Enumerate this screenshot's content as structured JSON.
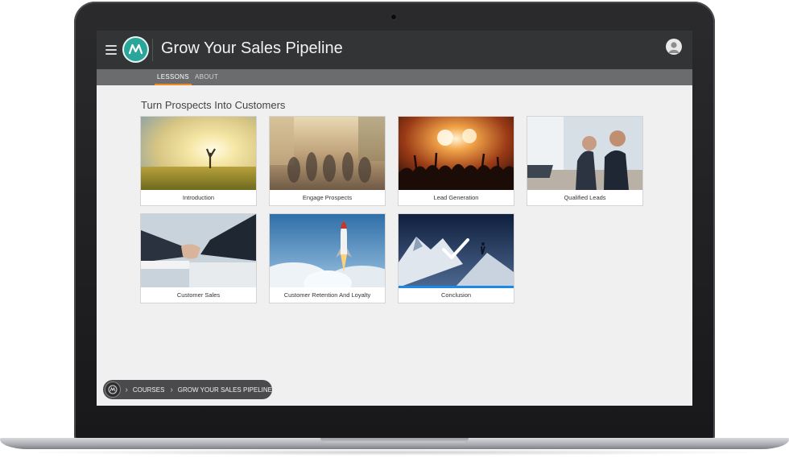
{
  "app": {
    "course_title": "Grow Your Sales Pipeline",
    "accent_color": "#2aa59a"
  },
  "tabs": [
    {
      "label": "LESSONS",
      "active": true
    },
    {
      "label": "ABOUT",
      "active": false
    }
  ],
  "section_title": "Turn Prospects Into Customers",
  "lessons": [
    {
      "title": "Introduction",
      "image": "sunrise-field-image",
      "completed": false
    },
    {
      "title": "Engage Prospects",
      "image": "crowd-street-image",
      "completed": false
    },
    {
      "title": "Lead Generation",
      "image": "concert-crowd-image",
      "completed": false
    },
    {
      "title": "Qualified Leads",
      "image": "business-meeting-image",
      "completed": false
    },
    {
      "title": "Customer Sales",
      "image": "handshake-image",
      "completed": false
    },
    {
      "title": "Customer Retention And Loyalty",
      "image": "rocket-launch-image",
      "completed": false
    },
    {
      "title": "Conclusion",
      "image": "mountain-summit-image",
      "completed": true,
      "progress": 1.0
    }
  ],
  "breadcrumb": {
    "items": [
      "COURSES",
      "GROW YOUR SALES PIPELINE"
    ]
  },
  "icons": {
    "menu": "hamburger-icon",
    "user": "user-avatar-icon",
    "home": "logo-home-icon",
    "completed": "checkmark-icon"
  }
}
